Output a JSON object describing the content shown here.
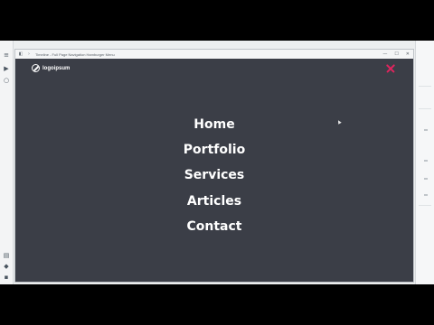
{
  "window": {
    "title": "Timeline - Full Page Navigation Hamburger Menu",
    "controls": {
      "minimize": "—",
      "maximize": "☐",
      "close": "✕"
    }
  },
  "site": {
    "logo_text": "logoipsum",
    "close_icon": "close-x",
    "accent_color": "#e0245e",
    "background_color": "#3b3e47",
    "nav": [
      {
        "label": "Home"
      },
      {
        "label": "Portfolio"
      },
      {
        "label": "Services"
      },
      {
        "label": "Articles"
      },
      {
        "label": "Contact"
      }
    ]
  },
  "left_rail": {
    "icons": [
      "menu-icon",
      "play-icon",
      "search-icon",
      "layers-icon",
      "stack-icon",
      "box-icon"
    ]
  }
}
